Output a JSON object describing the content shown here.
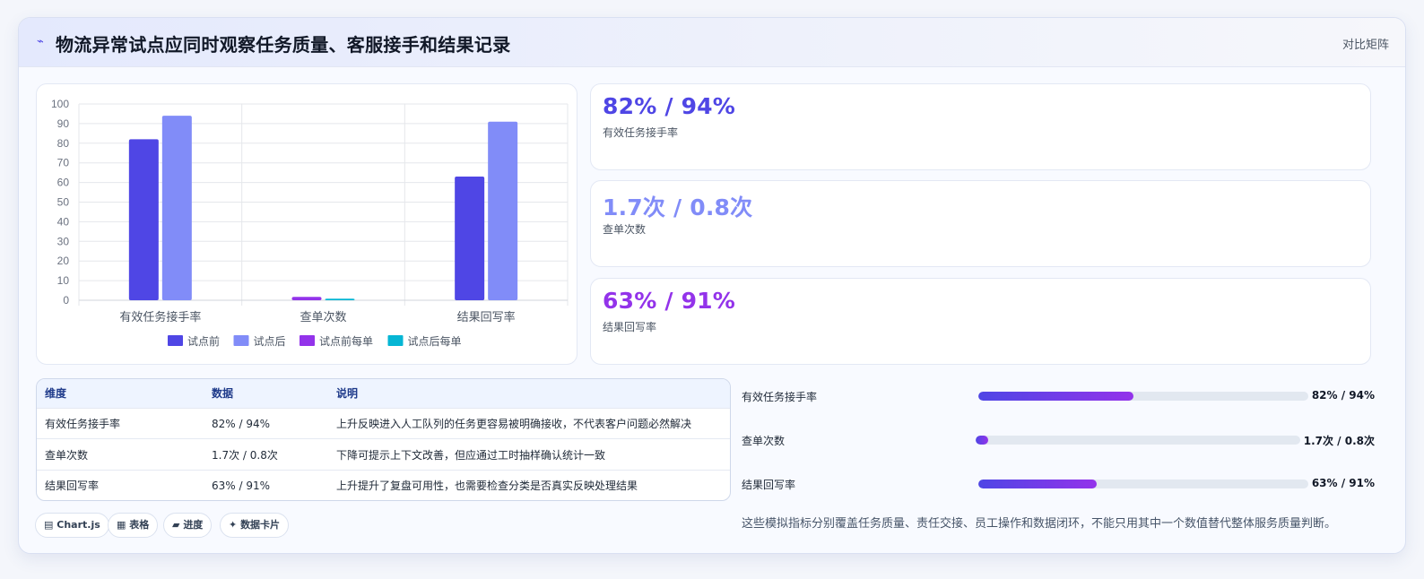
{
  "header": {
    "title": "物流异常试点应同时观察任务质量、客服接手和结果记录",
    "tag": "对比矩阵",
    "icon": "bolt-icon"
  },
  "chart_data": {
    "type": "bar",
    "categories": [
      "有效任务接手率",
      "查单次数",
      "结果回写率"
    ],
    "series": [
      {
        "name": "试点前",
        "color": "#4f46e5",
        "values": [
          82,
          null,
          63
        ]
      },
      {
        "name": "试点后",
        "color": "#818cf8",
        "values": [
          94,
          null,
          91
        ]
      },
      {
        "name": "试点前每单",
        "color": "#9333ea",
        "values": [
          null,
          1.7,
          null
        ]
      },
      {
        "name": "试点后每单",
        "color": "#06b6d4",
        "values": [
          null,
          0.8,
          null
        ]
      }
    ],
    "ylim": [
      0,
      100
    ],
    "yticks": [
      0,
      10,
      20,
      30,
      40,
      50,
      60,
      70,
      80,
      90,
      100
    ],
    "grid": true,
    "legend": "bottom"
  },
  "stats": [
    {
      "value": "82% / 94%",
      "label": "有效任务接手率",
      "color": "#4f46e5"
    },
    {
      "value": "1.7次 / 0.8次",
      "label": "查单次数",
      "color": "#818cf8"
    },
    {
      "value": "63% / 91%",
      "label": "结果回写率",
      "color": "#9333ea"
    }
  ],
  "table": {
    "headers": [
      "维度",
      "数据",
      "说明"
    ],
    "rows": [
      [
        "有效任务接手率",
        "82% / 94%",
        "上升反映进入人工队列的任务更容易被明确接收，不代表客户问题必然解决"
      ],
      [
        "查单次数",
        "1.7次 / 0.8次",
        "下降可提示上下文改善，但应通过工时抽样确认统计一致"
      ],
      [
        "结果回写率",
        "63% / 91%",
        "上升提升了复盘可用性，也需要检查分类是否真实反映处理结果"
      ]
    ]
  },
  "chips": [
    {
      "icon": "chart-icon",
      "glyph": "▤",
      "label": "Chart.js"
    },
    {
      "icon": "table-icon",
      "glyph": "▦",
      "label": "表格"
    },
    {
      "icon": "progress-icon",
      "glyph": "▰",
      "label": "进度"
    },
    {
      "icon": "sparkle-icon",
      "glyph": "✦",
      "label": "数据卡片"
    }
  ],
  "progress": [
    {
      "label": "有效任务接手率",
      "value": "82% / 94%",
      "fill": 0.47
    },
    {
      "label": "查单次数",
      "value": "1.7次 / 0.8次",
      "fill": 0.04
    },
    {
      "label": "结果回写率",
      "value": "63% / 91%",
      "fill": 0.36
    }
  ],
  "note": "这些模拟指标分别覆盖任务质量、责任交接、员工操作和数据闭环，不能只用其中一个数值替代整体服务质量判断。"
}
